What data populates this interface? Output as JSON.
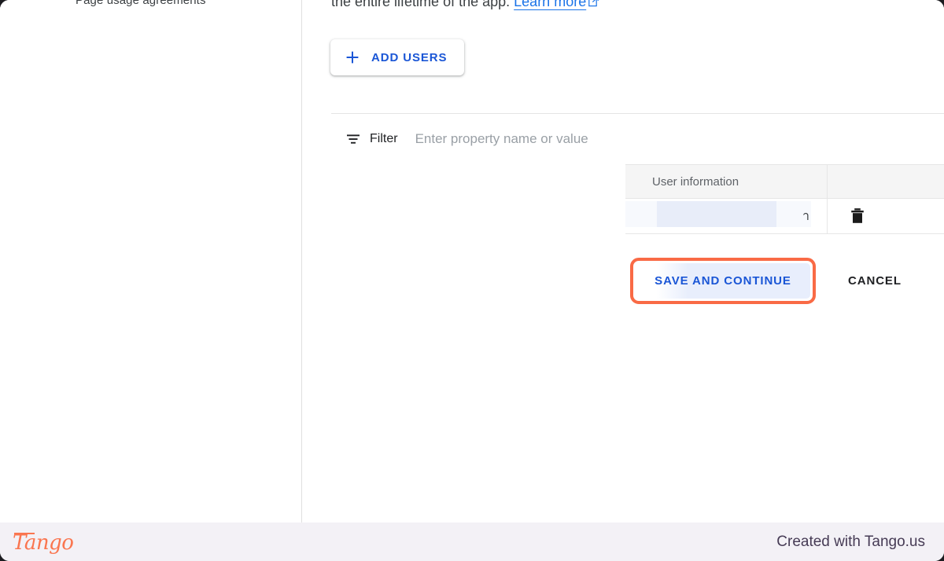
{
  "sidebar": {
    "items": [
      {
        "label": "Page usage agreements",
        "icon": "settings-gear-icon"
      }
    ]
  },
  "main": {
    "intro": {
      "text": "the entire lifetime of the app.",
      "link_label": "Learn more",
      "link_icon": "external-link-icon"
    },
    "add_users_button": {
      "label": "ADD USERS",
      "icon": "plus-icon"
    },
    "filter": {
      "icon": "filter-icon",
      "label": "Filter",
      "placeholder": "Enter property name or value",
      "value": "",
      "help_icon": "help-circle-icon"
    },
    "table": {
      "columns": [
        "User information",
        ""
      ],
      "rows": [
        {
          "user_information": "า",
          "redacted": true,
          "delete_icon": "trash-icon"
        }
      ]
    },
    "actions": {
      "primary_label": "SAVE AND CONTINUE",
      "secondary_label": "CANCEL",
      "highlight_color": "#f96a45",
      "primary_text_color": "#1a56d6"
    }
  },
  "footer": {
    "logo_text": "Tango",
    "credit": "Created with Tango.us",
    "logo_color": "#fa7650",
    "background": "#f3f1f6"
  }
}
